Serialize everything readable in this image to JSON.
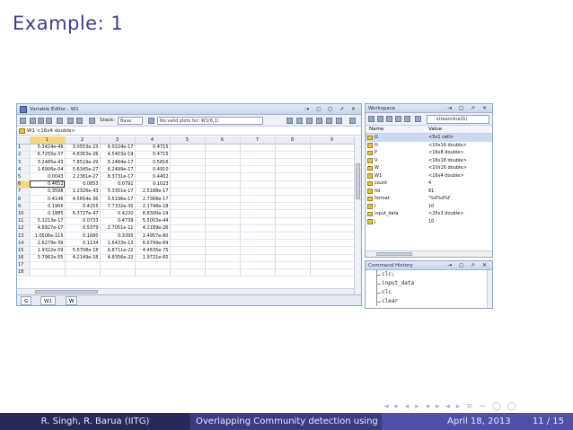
{
  "slide": {
    "title": "Example: 1",
    "footer_author": "R. Singh, R. Barua  (IITG)",
    "footer_title": "Overlapping Community detection using Baye",
    "footer_date": "April 18, 2013",
    "footer_page": "11 / 15",
    "nav_symbols": "◂ ▸ ◂ ▸ ◂ ▸ ◂ ▸ ≡ ∽ ◯ ◯"
  },
  "variable_editor": {
    "title": "Variable Editor - W1",
    "titlebar_buttons": "⇥ ◻ ◻ ↗ ✕",
    "stack_label": "Stack:",
    "stack_value": "Base",
    "plot_label": "No valid plots for: W1(6,1)",
    "info": "W1 <16x4 double>",
    "col_headers": [
      "",
      "1",
      "2",
      "3",
      "4",
      "5",
      "6",
      "7",
      "8",
      "9"
    ],
    "rows": [
      [
        "1",
        "5.3424e-45",
        "3.0553e-23",
        "6.0224e-17",
        "0.4715"
      ],
      [
        "2",
        "6.7255e-37",
        "4.8363e-26",
        "4.5403e-19",
        "0.4715"
      ],
      [
        "3",
        "3.2485e-43",
        "7.8519e-29",
        "5.2484e-17",
        "0.5816"
      ],
      [
        "4",
        "1.6906e-04",
        "5.6345e-27",
        "6.2499e-17",
        "0.4910"
      ],
      [
        "5",
        "0.0043",
        "2.2381e-27",
        "8.3731e-17",
        "0.4402"
      ],
      [
        "6",
        "0.4652",
        "0.0853",
        "0.0791",
        "0.1023"
      ],
      [
        "7",
        "0.3598",
        "1.2326e-43",
        "5.3351e-17",
        "2.5188e-17"
      ],
      [
        "8",
        "0.4146",
        "4.5654e-36",
        "5.5196e-17",
        "2.7368e-17"
      ],
      [
        "9",
        "0.1906",
        "0.4255",
        "7.7332e-30",
        "2.1748e-18"
      ],
      [
        "10",
        "0.1885",
        "6.3727e-47",
        "0.4220",
        "8.8300e-19"
      ],
      [
        "11",
        "5.1213e-17",
        "0.0733",
        "0.4739",
        "5.5003e-44"
      ],
      [
        "12",
        "4.6927e-17",
        "0.5379",
        "2.7051e-11",
        "4.2189e-26"
      ],
      [
        "13",
        "1.0506e-115",
        "0.1680",
        "0.3395",
        "2.4957e-80"
      ],
      [
        "14",
        "2.6279e-39",
        "0.1134",
        "1.6433e-13",
        "6.6799e-69"
      ],
      [
        "15",
        "1.9322e-59",
        "5.6708e-18",
        "6.8711e-22",
        "4.4635e-75"
      ],
      [
        "16",
        "5.7962e-55",
        "4.2149e-18",
        "4.8356e-22",
        "1.9721e-65"
      ],
      [
        "17",
        "",
        "",
        "",
        ""
      ],
      [
        "18",
        "",
        "",
        "",
        ""
      ]
    ],
    "tabs": [
      "G",
      "W1",
      "W"
    ]
  },
  "workspace": {
    "title": "Workspace",
    "titlebar_buttons": "⇥ ◻ ↗ ✕",
    "dropdown": "streamline(G)",
    "col_name": "Name",
    "col_value": "Value",
    "vars": [
      {
        "name": "G",
        "value": "<5x1 cell>"
      },
      {
        "name": "H",
        "value": "<10x16 double>"
      },
      {
        "name": "P",
        "value": "<16x8 double>"
      },
      {
        "name": "V",
        "value": "<16x16 double>"
      },
      {
        "name": "W",
        "value": "<10x16 double>"
      },
      {
        "name": "W1",
        "value": "<16x4 double>"
      },
      {
        "name": "count",
        "value": "4"
      },
      {
        "name": "fid",
        "value": "81"
      },
      {
        "name": "format",
        "value": "'%d%d%f'"
      },
      {
        "name": "i",
        "value": "10"
      },
      {
        "name": "input_data",
        "value": "<25x3 double>"
      },
      {
        "name": "j",
        "value": "10"
      }
    ]
  },
  "command_history": {
    "title": "Command History",
    "titlebar_buttons": "⇥ ◻ ↗ ✕",
    "lines": [
      "clc;",
      "input_data",
      "clc",
      "clear"
    ]
  }
}
